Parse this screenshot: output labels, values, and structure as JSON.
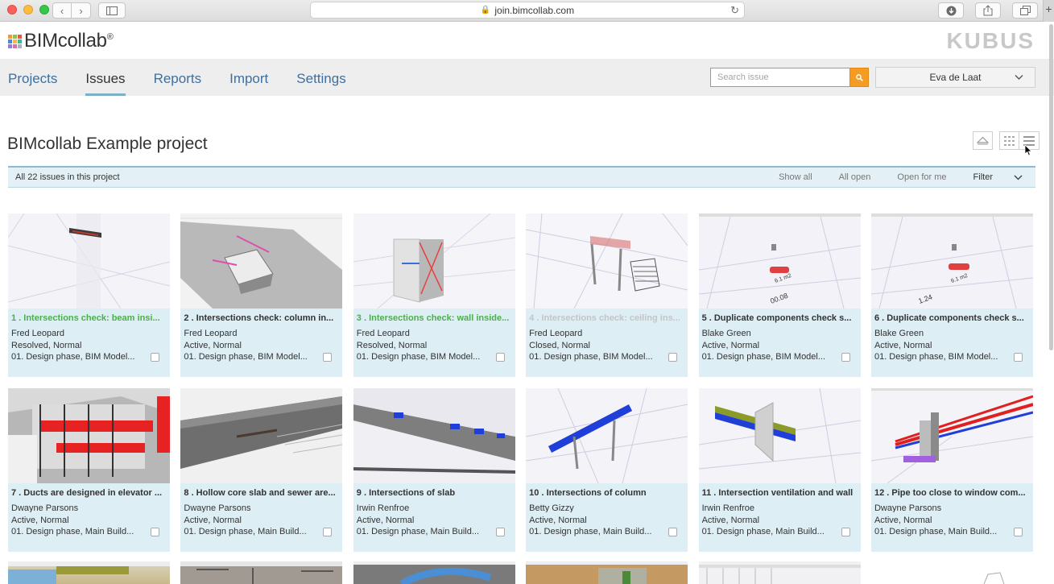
{
  "browser": {
    "url": "join.bimcollab.com"
  },
  "app": {
    "logo_text": "BIMcollab",
    "logo_reg": "®",
    "vendor_logo": "KUBUS"
  },
  "nav": {
    "items": [
      {
        "label": "Projects",
        "active": false
      },
      {
        "label": "Issues",
        "active": true
      },
      {
        "label": "Reports",
        "active": false
      },
      {
        "label": "Import",
        "active": false
      },
      {
        "label": "Settings",
        "active": false
      }
    ],
    "search_placeholder": "Search issue",
    "user": "Eva de Laat"
  },
  "project": {
    "title": "BIMcollab Example project",
    "issue_count_text": "All 22 issues in this project",
    "filters": {
      "show_all": "Show all",
      "all_open": "All open",
      "open_for_me": "Open for me",
      "filter": "Filter"
    }
  },
  "colors": {
    "accent": "#3f6f9e",
    "search_button": "#f59a23",
    "card_bg": "#ddeef4",
    "resolved_title": "#4cb04a",
    "closed_title": "#c5c5c5"
  },
  "issues": [
    {
      "title": "1 . Intersections check: beam insi...",
      "assignee": "Fred Leopard",
      "status": "Resolved, Normal",
      "phase": "01. Design phase, BIM Model...",
      "title_style": "green"
    },
    {
      "title": "2 . Intersections check: column in...",
      "assignee": "Fred Leopard",
      "status": "Active, Normal",
      "phase": "01. Design phase, BIM Model...",
      "title_style": "normal"
    },
    {
      "title": "3 . Intersections check: wall inside...",
      "assignee": "Fred Leopard",
      "status": "Resolved, Normal",
      "phase": "01. Design phase, BIM Model...",
      "title_style": "green"
    },
    {
      "title": "4 . Intersections check: ceiling ins...",
      "assignee": "Fred Leopard",
      "status": "Closed, Normal",
      "phase": "01. Design phase, BIM Model...",
      "title_style": "grey"
    },
    {
      "title": "5 . Duplicate components check s...",
      "assignee": "Blake Green",
      "status": "Active, Normal",
      "phase": "01. Design phase, BIM Model...",
      "title_style": "normal"
    },
    {
      "title": "6 . Duplicate components check s...",
      "assignee": "Blake Green",
      "status": "Active, Normal",
      "phase": "01. Design phase, BIM Model...",
      "title_style": "normal"
    },
    {
      "title": "7 . Ducts are designed in elevator ...",
      "assignee": "Dwayne Parsons",
      "status": "Active, Normal",
      "phase": "01. Design phase, Main Build...",
      "title_style": "normal"
    },
    {
      "title": "8 . Hollow core slab and sewer are...",
      "assignee": "Dwayne Parsons",
      "status": "Active, Normal",
      "phase": "01. Design phase, Main Build...",
      "title_style": "normal"
    },
    {
      "title": "9 . Intersections of slab",
      "assignee": "Irwin Renfroe",
      "status": "Active, Normal",
      "phase": "01. Design phase, Main Build...",
      "title_style": "normal"
    },
    {
      "title": "10 . Intersections of column",
      "assignee": "Betty Gizzy",
      "status": "Active, Normal",
      "phase": "01. Design phase, Main Build...",
      "title_style": "normal"
    },
    {
      "title": "11 . Intersection ventilation and wall",
      "assignee": "Irwin Renfroe",
      "status": "Active, Normal",
      "phase": "01. Design phase, Main Build...",
      "title_style": "normal"
    },
    {
      "title": "12 . Pipe too close to window com...",
      "assignee": "Dwayne Parsons",
      "status": "Active, Normal",
      "phase": "01. Design phase, Main Build...",
      "title_style": "normal"
    }
  ]
}
